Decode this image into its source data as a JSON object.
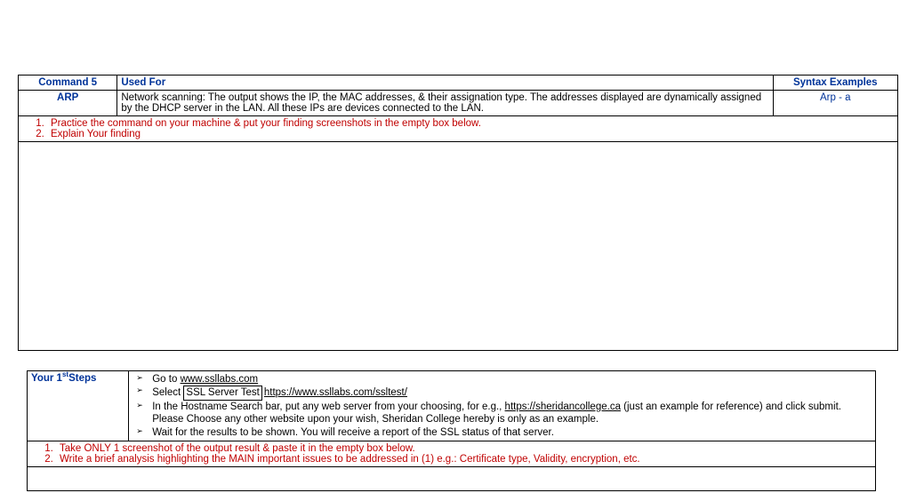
{
  "table1": {
    "header": {
      "c1": "Command 5",
      "c2": "Used For",
      "c3": "Syntax Examples"
    },
    "row": {
      "c1": "ARP",
      "c2": "Network scanning: The output shows the IP, the MAC addresses, & their assignation type. The addresses displayed are dynamically assigned by the DHCP server in the LAN. All these IPs are devices connected to the LAN.",
      "c3": "Arp - a"
    },
    "red1": "Practice the command on your machine & put your finding screenshots in the empty box below.",
    "red2": "Explain Your finding"
  },
  "table2": {
    "left_label_a": "Your 1",
    "left_label_sup": "st",
    "left_label_b": "Steps",
    "b_goto": "Go to ",
    "b_url1": "www.ssllabs.com",
    "b_select": "Select ",
    "b_boxed": "SSL Server Test",
    "b_url2": "https://www.ssllabs.com/ssltest/",
    "b_host_a": "In the Hostname Search bar, put any web server from your choosing, for e.g., ",
    "b_host_link": "https://sheridancollege.ca",
    "b_host_b": " (just an example for reference) and click submit. Please Choose any other website upon your wish, Sheridan College hereby is only as an example.",
    "b_wait": "Wait for the results to be shown. You will receive a report of the SSL status of that server.",
    "red1": "Take ONLY 1 screenshot of the output result & paste it in the empty box below.",
    "red2": "Write a brief analysis highlighting the MAIN important issues to be addressed in (1) e.g.: Certificate type, Validity, encryption, etc."
  }
}
